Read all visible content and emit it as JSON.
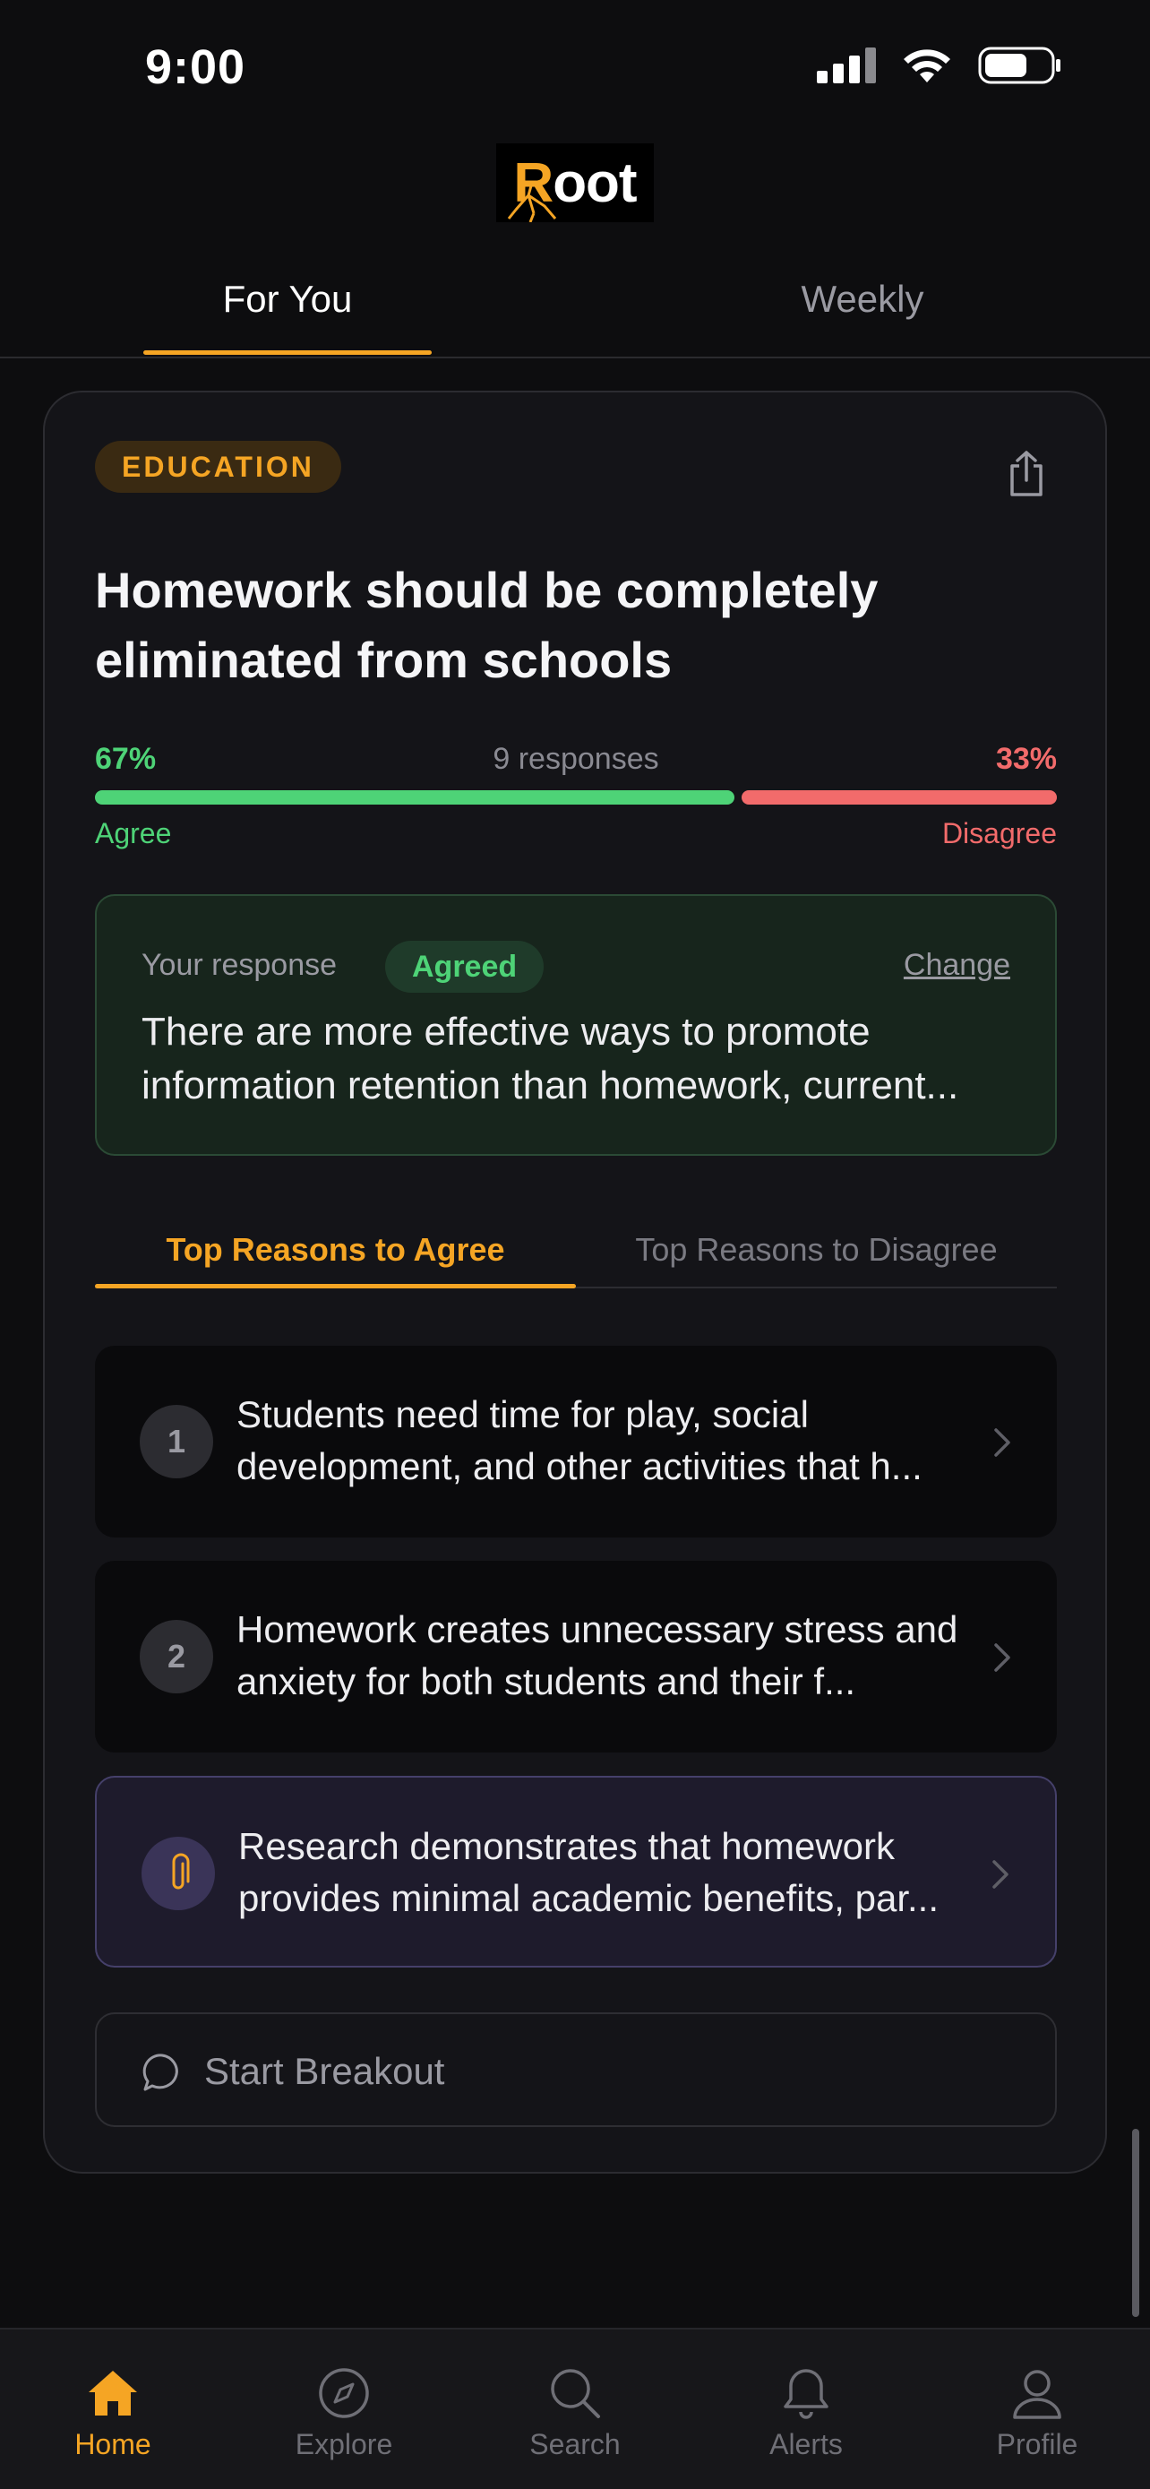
{
  "status_bar": {
    "time": "9:00"
  },
  "app": {
    "logo_text_first": "R",
    "logo_text_rest": "oot"
  },
  "top_tabs": [
    {
      "label": "For You",
      "active": true
    },
    {
      "label": "Weekly",
      "active": false
    }
  ],
  "card": {
    "category": "EDUCATION",
    "question": "Homework should be completely eliminated from schools",
    "agree_percent": "67%",
    "disagree_percent": "33%",
    "agree_fraction": 0.67,
    "responses": "9 responses",
    "agree_label": "Agree",
    "disagree_label": "Disagree",
    "your_response": {
      "label": "Your response",
      "status": "Agreed",
      "change_label": "Change",
      "text": "There are more effective ways to promote information retention than homework, current..."
    },
    "reason_tabs": [
      {
        "label": "Top Reasons to Agree",
        "active": true
      },
      {
        "label": "Top Reasons to Disagree",
        "active": false
      }
    ],
    "reasons": [
      {
        "marker": "1",
        "text": "Students need time for play, social development, and other activities that h..."
      },
      {
        "marker": "2",
        "text": "Homework creates unnecessary stress and anxiety for both students and their f..."
      },
      {
        "marker": "paperclip-icon",
        "text": "Research demonstrates that homework provides minimal academic benefits, par..."
      }
    ],
    "breakout_label": "Start Breakout"
  },
  "bottom_nav": [
    {
      "label": "Home",
      "icon": "home-icon",
      "active": true
    },
    {
      "label": "Explore",
      "icon": "compass-icon",
      "active": false
    },
    {
      "label": "Search",
      "icon": "search-icon",
      "active": false
    },
    {
      "label": "Alerts",
      "icon": "bell-icon",
      "active": false
    },
    {
      "label": "Profile",
      "icon": "person-icon",
      "active": false
    }
  ],
  "colors": {
    "accent": "#f5a524",
    "agree": "#4ed377",
    "disagree": "#f26b6b",
    "background": "#0d0d0f"
  }
}
